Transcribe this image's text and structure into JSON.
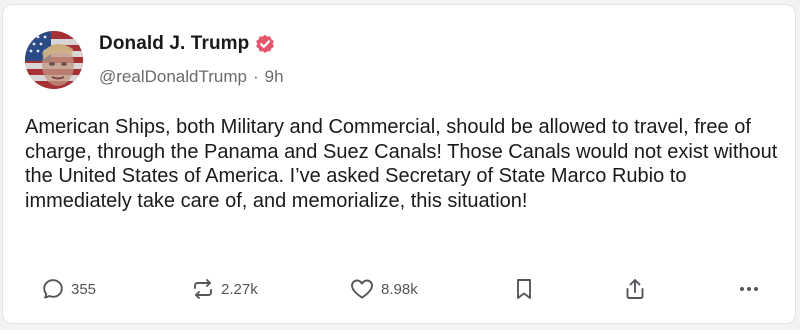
{
  "post": {
    "author": {
      "display_name": "Donald J. Trump",
      "handle": "@realDonaldTrump",
      "timestamp": "9h",
      "separator": "·",
      "verified": true,
      "verified_color": "#e4576e"
    },
    "text": "American Ships, both Military and Commercial, should be allowed to travel, free of charge, through the Panama and Suez Canals! Those Canals would not exist without the United States of America. I’ve asked Secretary of State Marco Rubio to immediately take care of, and memorialize, this situation!",
    "actions": {
      "replies": {
        "icon": "reply-icon",
        "count": "355"
      },
      "retruths": {
        "icon": "repost-icon",
        "count": "2.27k"
      },
      "likes": {
        "icon": "heart-icon",
        "count": "8.98k"
      },
      "bookmark": {
        "icon": "bookmark-icon"
      },
      "share": {
        "icon": "share-icon"
      },
      "more": {
        "icon": "more-icon"
      }
    }
  }
}
